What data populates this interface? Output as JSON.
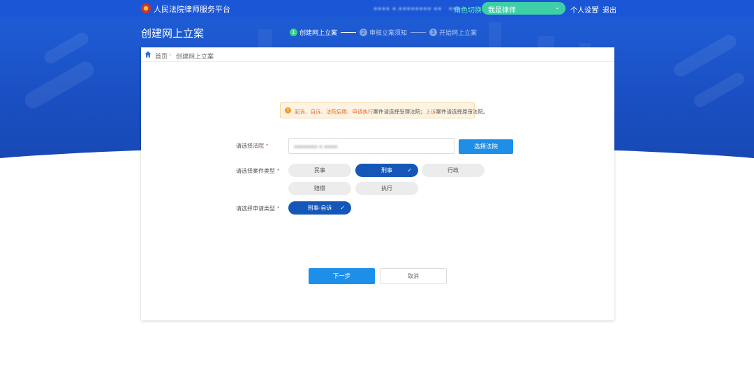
{
  "topbar": {
    "brand": "人民法院律师服务平台",
    "account_masked": "●●●● ●.●●●●●●●● ●● ·  ●●●",
    "role_label": "角色切换",
    "role_value": "我是律师",
    "user_settings": "个人设置",
    "logout": "退出"
  },
  "header": {
    "title": "创建网上立案",
    "steps": [
      {
        "num": "1",
        "label": "创建网上立案",
        "state": "active"
      },
      {
        "num": "2",
        "label": "审核立案须知",
        "state": "inactive"
      },
      {
        "num": "3",
        "label": "开始网上立案",
        "state": "inactive"
      }
    ]
  },
  "breadcrumb": {
    "home": "首页",
    "current": "创建网上立案"
  },
  "notice": {
    "hl1": "起诉、自诉、法院启限、申请执行",
    "text1": "案件请选择受理法院；",
    "hl2": "上诉",
    "text2": "案件请选择原审法院。"
  },
  "form": {
    "court_label": "请选择法院",
    "court_value_masked": "●●●●●●● ● ●●●●",
    "select_court_button": "选择法院",
    "case_type_label": "请选择案件类型",
    "case_types": [
      {
        "label": "民事",
        "selected": false
      },
      {
        "label": "刑事",
        "selected": true
      },
      {
        "label": "行政",
        "selected": false
      },
      {
        "label": "赔偿",
        "selected": false
      },
      {
        "label": "执行",
        "selected": false
      }
    ],
    "apply_type_label": "请选择申请类型",
    "apply_types": [
      {
        "label": "刑事-自诉",
        "selected": true
      }
    ],
    "required_mark": "*"
  },
  "actions": {
    "next": "下一步",
    "cancel": "取消"
  },
  "colors": {
    "primary": "#1e8fe8",
    "selected_pill": "#1557b8",
    "hero": "#1a4fc2",
    "accent": "#3ecfa8"
  }
}
